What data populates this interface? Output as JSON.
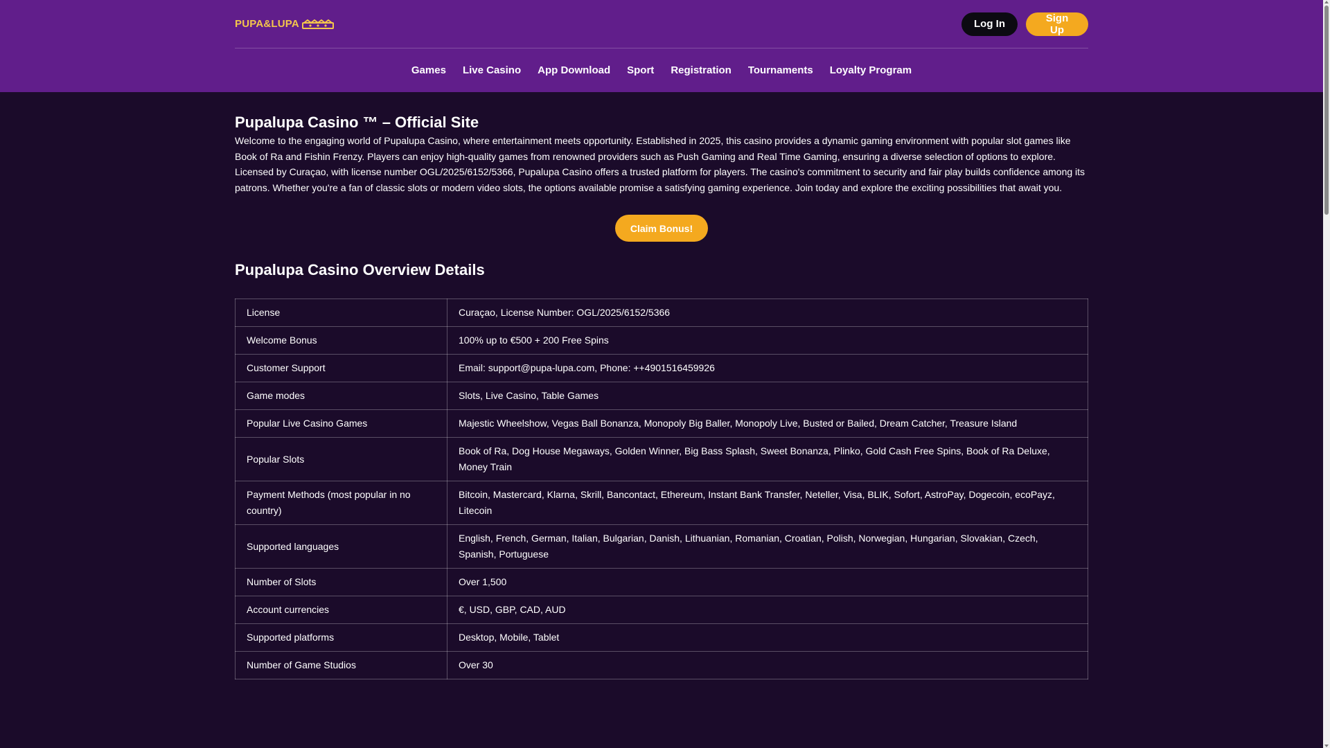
{
  "header": {
    "logo_text": "PUPA&LUPA",
    "login_label": "Log In",
    "signup_label": "Sign Up",
    "nav": [
      "Games",
      "Live Casino",
      "App Download",
      "Sport",
      "Registration",
      "Tournaments",
      "Loyalty Program"
    ]
  },
  "main": {
    "title": "Pupalupa Casino ™ – Official Site",
    "paragraphs": [
      "Welcome to the engaging world of Pupalupa Casino, where entertainment meets opportunity. Established in 2025, this casino provides a dynamic gaming environment with popular slot games like Book of Ra and Fishin Frenzy. Players can enjoy high-quality games from renowned providers such as Push Gaming and Real Time Gaming, ensuring a diverse selection of options to explore.",
      "Licensed by Curaçao, with license number OGL/2025/6152/5366, Pupalupa Casino offers a trusted platform for players. The casino's commitment to security and fair play builds confidence among its patrons. Whether you're a fan of classic slots or modern video slots, the options available promise a satisfying gaming experience. Join today and explore the exciting possibilities that await you."
    ],
    "cta_label": "Claim Bonus!",
    "overview_title": "Pupalupa Casino Overview Details",
    "table": [
      [
        "License",
        "Curaçao, License Number: OGL/2025/6152/5366"
      ],
      [
        "Welcome Bonus",
        "100% up to €500 + 200 Free Spins"
      ],
      [
        "Customer Support",
        "Email: support@pupa-lupa.com, Phone: ++4901516459926"
      ],
      [
        "Game modes",
        "Slots, Live Casino, Table Games"
      ],
      [
        "Popular Live Casino Games",
        "Majestic Wheelshow, Vegas Ball Bonanza, Monopoly Big Baller, Monopoly Live, Busted or Bailed, Dream Catcher, Treasure Island"
      ],
      [
        "Popular Slots",
        "Book of Ra, Dog House Megaways, Golden Winner, Big Bass Splash, Sweet Bonanza, Plinko, Gold Cash Free Spins, Book of Ra Deluxe, Money Train"
      ],
      [
        "Payment Methods (most popular in no country)",
        "Bitcoin, Mastercard, Klarna, Skrill, Bancontact, Ethereum, Instant Bank Transfer, Neteller, Visa, BLIK, Sofort, AstroPay, Dogecoin, ecoPayz, Litecoin"
      ],
      [
        "Supported languages",
        "English, French, German, Italian, Bulgarian, Danish, Lithuanian, Romanian, Croatian, Polish, Norwegian, Hungarian, Slovakian, Czech, Spanish, Portuguese"
      ],
      [
        "Number of Slots",
        "Over 1,500"
      ],
      [
        "Account currencies",
        "€, USD, GBP, CAD, AUD"
      ],
      [
        "Supported platforms",
        "Desktop, Mobile, Tablet"
      ],
      [
        "Number of Game Studios",
        "Over 30"
      ]
    ]
  },
  "colors": {
    "header_bg": "#611e8b",
    "page_bg": "#1b0b2a",
    "accent": "#f4a91f",
    "logo": "#f4c64b"
  }
}
